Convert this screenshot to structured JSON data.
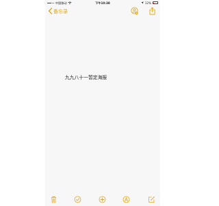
{
  "status_bar": {
    "carrier": "中国移动",
    "time": "下午10:38",
    "battery_percent": "12%",
    "battery_level": 0.12
  },
  "nav": {
    "back_label": "备忘录"
  },
  "note": {
    "content": "九九八十一暂定海报"
  },
  "toolbar": {
    "items": [
      "trash-icon",
      "checklist-icon",
      "add-icon",
      "markup-icon",
      "compose-icon"
    ]
  },
  "colors": {
    "accent": "#e0a81e",
    "background": "#f7f7f7",
    "battery_low": "#e03a2f"
  }
}
